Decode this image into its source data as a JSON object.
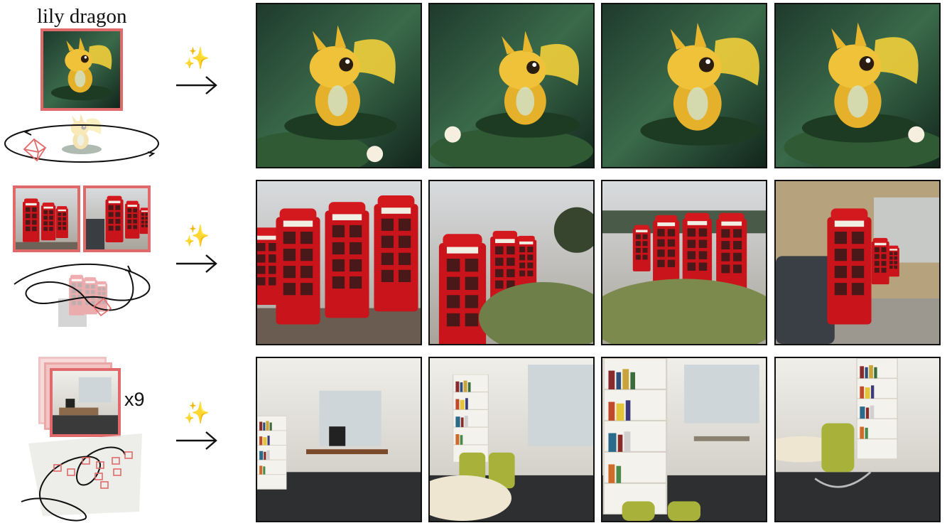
{
  "rows": [
    {
      "caption": "lily dragon",
      "input_kind": "single image",
      "outputs": [
        "dragon view 1",
        "dragon view 2",
        "dragon view 3",
        "dragon view 4"
      ]
    },
    {
      "caption": "",
      "input_kind": "two images",
      "outputs": [
        "phone booths view 1",
        "phone booths view 2",
        "phone booths view 3",
        "phone booths view 4"
      ]
    },
    {
      "caption": "",
      "input_kind": "image stack",
      "count_label": "x9",
      "outputs": [
        "office view 1",
        "office view 2",
        "office view 3",
        "office view 4"
      ]
    }
  ],
  "sparkle_icon": "sparkles-icon",
  "arrow_icon": "right-arrow-icon",
  "colors": {
    "input_border": "#e06a6a",
    "output_border": "#111111",
    "camera_frustum": "#e06a6a"
  }
}
